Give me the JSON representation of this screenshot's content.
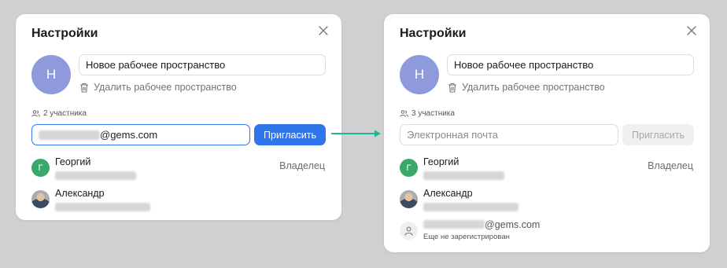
{
  "left": {
    "title": "Настройки",
    "avatar_letter": "Н",
    "workspace_name": "Новое рабочее пространство",
    "delete_label": "Удалить рабочее пространство",
    "participants_count": "2 участника",
    "email_value": "@gems.com",
    "invite_label": "Пригласить",
    "members": [
      {
        "name": "Георгий",
        "initial": "Г",
        "role": "Владелец"
      },
      {
        "name": "Александр"
      }
    ]
  },
  "right": {
    "title": "Настройки",
    "avatar_letter": "Н",
    "workspace_name": "Новое рабочее пространство",
    "delete_label": "Удалить рабочее пространство",
    "participants_count": "3 участника",
    "email_placeholder": "Электронная почта",
    "invite_label": "Пригласить",
    "members": [
      {
        "name": "Георгий",
        "initial": "Г",
        "role": "Владелец"
      },
      {
        "name": "Александр"
      },
      {
        "email": "@gems.com",
        "status": "Еще не зарегистрирован"
      }
    ]
  },
  "colors": {
    "primary": "#2f76ea",
    "avatar": "#8e9adb",
    "owner_avatar": "#3aa86b",
    "arrow": "#22b39a"
  },
  "icons": [
    "close-icon",
    "trash-icon",
    "users-icon",
    "user-icon",
    "arrow-right-icon"
  ]
}
